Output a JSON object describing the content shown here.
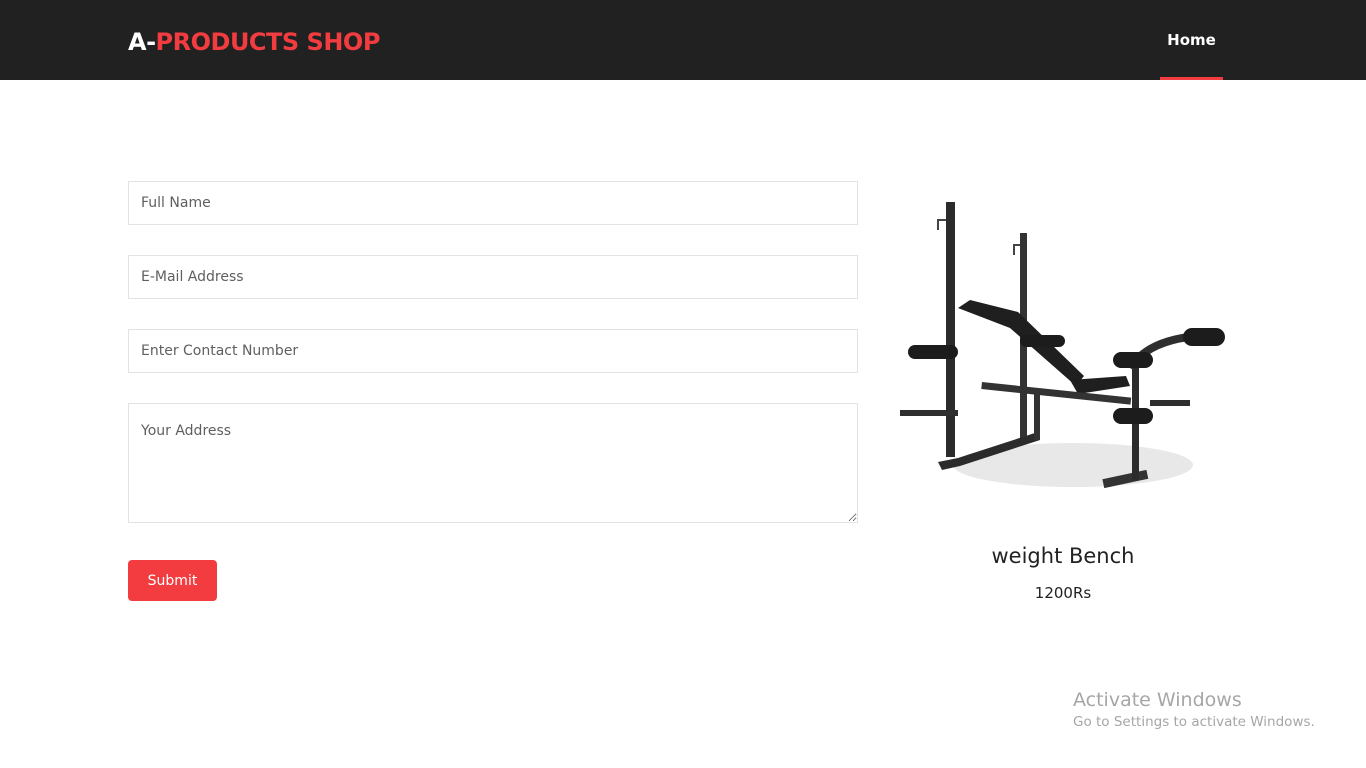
{
  "header": {
    "brand_prefix": "A-",
    "brand_rest": "PRODUCTS SHOP",
    "nav": [
      {
        "label": "Home",
        "active": true
      }
    ]
  },
  "form": {
    "full_name": {
      "value": "",
      "placeholder": "Full Name"
    },
    "email": {
      "value": "",
      "placeholder": "E-Mail Address"
    },
    "contact": {
      "value": "",
      "placeholder": "Enter Contact Number"
    },
    "address": {
      "value": "",
      "placeholder": "Your Address"
    },
    "submit_label": "Submit"
  },
  "product": {
    "name": "weight Bench",
    "price": "1200Rs",
    "image_icon": "weight-bench-image"
  },
  "watermark": {
    "title": "Activate Windows",
    "subtitle": "Go to Settings to activate Windows."
  },
  "colors": {
    "header_bg": "#212121",
    "accent": "#f23c3f",
    "text": "#222222"
  }
}
